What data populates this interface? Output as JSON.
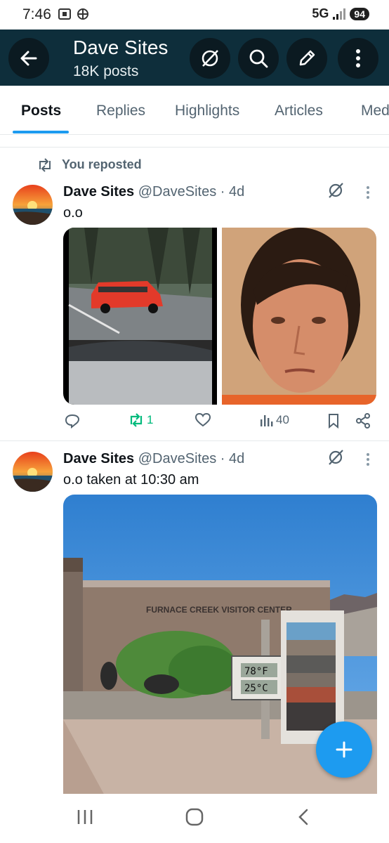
{
  "status": {
    "time": "7:46",
    "network": "5G",
    "battery": "94"
  },
  "header": {
    "title": "Dave Sites",
    "subtitle": "18K posts"
  },
  "tabs": [
    {
      "label": "Posts",
      "active": true
    },
    {
      "label": "Replies"
    },
    {
      "label": "Highlights"
    },
    {
      "label": "Articles"
    },
    {
      "label": "Med"
    }
  ],
  "repost_label": "You reposted",
  "posts": [
    {
      "name": "Dave Sites",
      "handle": "@DaveSites",
      "time": "· 4d",
      "text": "o.o",
      "actions": {
        "reposts": "1",
        "views": "40"
      }
    },
    {
      "name": "Dave Sites",
      "handle": "@DaveSites",
      "time": "· 4d",
      "text": "o.o taken at 10:30  am",
      "photo": {
        "sign": "FURNACE CREEK VISITOR CENTER",
        "temp_f": "78°F",
        "temp_c": "25°C"
      }
    }
  ],
  "colors": {
    "header_bg": "#0e2e3b",
    "accent": "#1d9bf0",
    "repost_green": "#00ba7c"
  }
}
